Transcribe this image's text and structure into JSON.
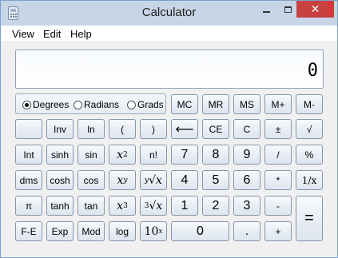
{
  "window": {
    "title": "Calculator",
    "close_glyph": "✕"
  },
  "menu": [
    "View",
    "Edit",
    "Help"
  ],
  "display": {
    "value": "0"
  },
  "angle": {
    "options": [
      "Degrees",
      "Radians",
      "Grads"
    ],
    "selected": "Degrees"
  },
  "memory": [
    "MC",
    "MR",
    "MS",
    "M+",
    "M-"
  ],
  "keys": {
    "inv": "Inv",
    "ln": "ln",
    "lparen": "(",
    "rparen": ")",
    "backspace": "⟵",
    "ce": "CE",
    "c": "C",
    "plusminus": "±",
    "sqrt": "√",
    "int": "Int",
    "sinh": "sinh",
    "sin": "sin",
    "x2_base": "x",
    "x2_exp": "2",
    "fact": "n!",
    "d7": "7",
    "d8": "8",
    "d9": "9",
    "div": "/",
    "pct": "%",
    "dms": "dms",
    "cosh": "cosh",
    "cos": "cos",
    "xy_base": "x",
    "xy_exp": "y",
    "yroot_idx": "y",
    "yroot_sym": "√",
    "yroot_base": "x",
    "d4": "4",
    "d5": "5",
    "d6": "6",
    "mul": "*",
    "recip": "1/x",
    "pi": "π",
    "tanh": "tanh",
    "tan": "tan",
    "x3_base": "x",
    "x3_exp": "3",
    "cbrt_idx": "3",
    "cbrt_sym": "√",
    "cbrt_base": "x",
    "d1": "1",
    "d2": "2",
    "d3": "3",
    "sub": "-",
    "eq": "=",
    "fe": "F-E",
    "exp": "Exp",
    "mod": "Mod",
    "log": "log",
    "ten_base": "10",
    "ten_exp": "x",
    "d0": "0",
    "dot": ".",
    "add": "+"
  }
}
